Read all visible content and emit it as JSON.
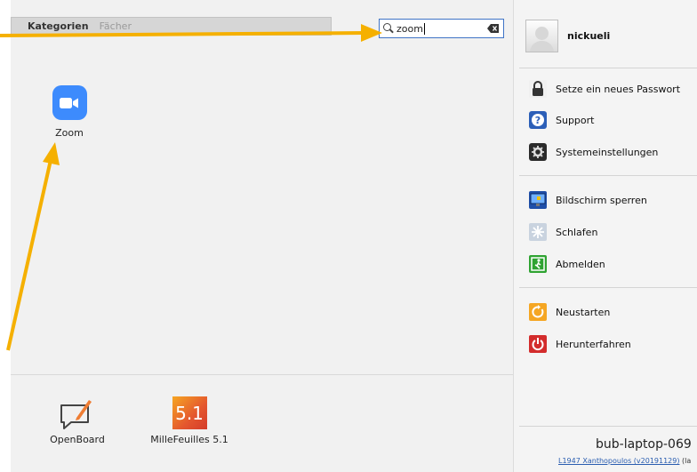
{
  "tabs": {
    "categories": "Kategorien",
    "subjects": "Fächer"
  },
  "search": {
    "value": "zoom"
  },
  "results": [
    {
      "label": "Zoom",
      "icon": "zoom-video-icon"
    }
  ],
  "favorites": [
    {
      "label": "OpenBoard",
      "icon": "openboard-icon"
    },
    {
      "label": "MilleFeuilles 5.1",
      "icon": "millefeuilles-icon",
      "icon_text": "5.1"
    }
  ],
  "user": {
    "name": "nickueli"
  },
  "menu": {
    "group1": [
      {
        "label": "Setze ein neues Passwort",
        "icon": "lock-icon"
      },
      {
        "label": "Support",
        "icon": "help-icon"
      },
      {
        "label": "Systemeinstellungen",
        "icon": "settings-icon"
      }
    ],
    "group2": [
      {
        "label": "Bildschirm sperren",
        "icon": "lock-screen-icon"
      },
      {
        "label": "Schlafen",
        "icon": "sleep-icon"
      },
      {
        "label": "Abmelden",
        "icon": "logout-icon"
      }
    ],
    "group3": [
      {
        "label": "Neustarten",
        "icon": "restart-icon"
      },
      {
        "label": "Herunterfahren",
        "icon": "power-icon"
      }
    ]
  },
  "footer": {
    "hostname": "bub-laptop-069",
    "version_link": "L1947 Xanthopoulos (v20191129)",
    "version_extra": "(la"
  },
  "colors": {
    "accent": "#3f74c6",
    "annotation_arrow": "#f5b000",
    "zoom_blue": "#3d8bfd"
  }
}
